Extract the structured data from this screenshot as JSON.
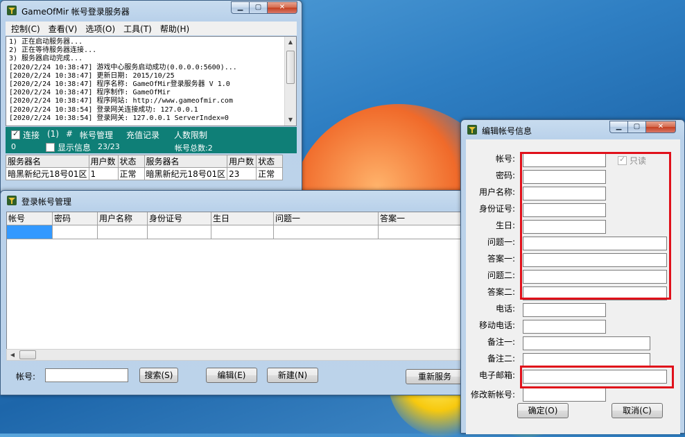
{
  "server_window": {
    "title": "GameOfMir 帐号登录服务器",
    "caption_buttons": {
      "minimize": "▁",
      "maximize": "▢",
      "close": "✕"
    },
    "menu": [
      "控制(C)",
      "查看(V)",
      "选项(O)",
      "工具(T)",
      "帮助(H)"
    ],
    "log": [
      "1) 正在启动服务器...",
      "2) 正在等待服务器连接...",
      "3) 服务器启动完成...",
      "[2020/2/24 10:38:47] 游戏中心服务启动成功(0.0.0.0:5600)...",
      "[2020/2/24 10:38:47] 更新日期: 2015/10/25",
      "[2020/2/24 10:38:47] 程序名称: GameOfMir登录服务器 V 1.0",
      "[2020/2/24 10:38:47] 程序制作: GameOfMir",
      "[2020/2/24 10:38:47] 程序网站: http://www.gameofmir.com",
      "[2020/2/24 10:38:54] 登录网关连接成功: 127.0.0.1",
      "[2020/2/24 10:38:54] 登录网关: 127.0.0.1 ServerIndex=0"
    ],
    "status_bar": {
      "connect_label": "连接",
      "connect_count": "(1)",
      "hash": "#",
      "account_mgmt": "帐号管理",
      "recharge": "充值记录",
      "limit": "人数限制",
      "zero": "0",
      "show_info": "显示信息",
      "ratio": "23/23",
      "total": "帐号总数:2"
    },
    "server_table": {
      "headers": [
        "服务器名",
        "用户数",
        "状态",
        "服务器名",
        "用户数",
        "状态"
      ],
      "row": [
        "暗黑新纪元18号01区",
        "1",
        "正常",
        "暗黑新纪元18号01区",
        "23",
        "正常"
      ]
    }
  },
  "account_window": {
    "title": "登录帐号管理",
    "columns": [
      "帐号",
      "密码",
      "用户名称",
      "身份证号",
      "生日",
      "问题一",
      "答案一"
    ],
    "account_label": "帐号:",
    "search_btn": "搜索(S)",
    "edit_btn": "编辑(E)",
    "new_btn": "新建(N)",
    "reload_btn": "重新服务"
  },
  "edit_window": {
    "title": "编辑帐号信息",
    "readonly_label": "只读",
    "fields": [
      "帐号:",
      "密码:",
      "用户名称:",
      "身份证号:",
      "生日:",
      "问题一:",
      "答案一:",
      "问题二:",
      "答案二:",
      "电话:",
      "移动电话:",
      "备注一:",
      "备注二:",
      "电子邮箱:",
      "修改新帐号:"
    ],
    "ok_btn": "确定(O)",
    "cancel_btn": "取消(C)",
    "highlight_color": "#e0101a"
  }
}
